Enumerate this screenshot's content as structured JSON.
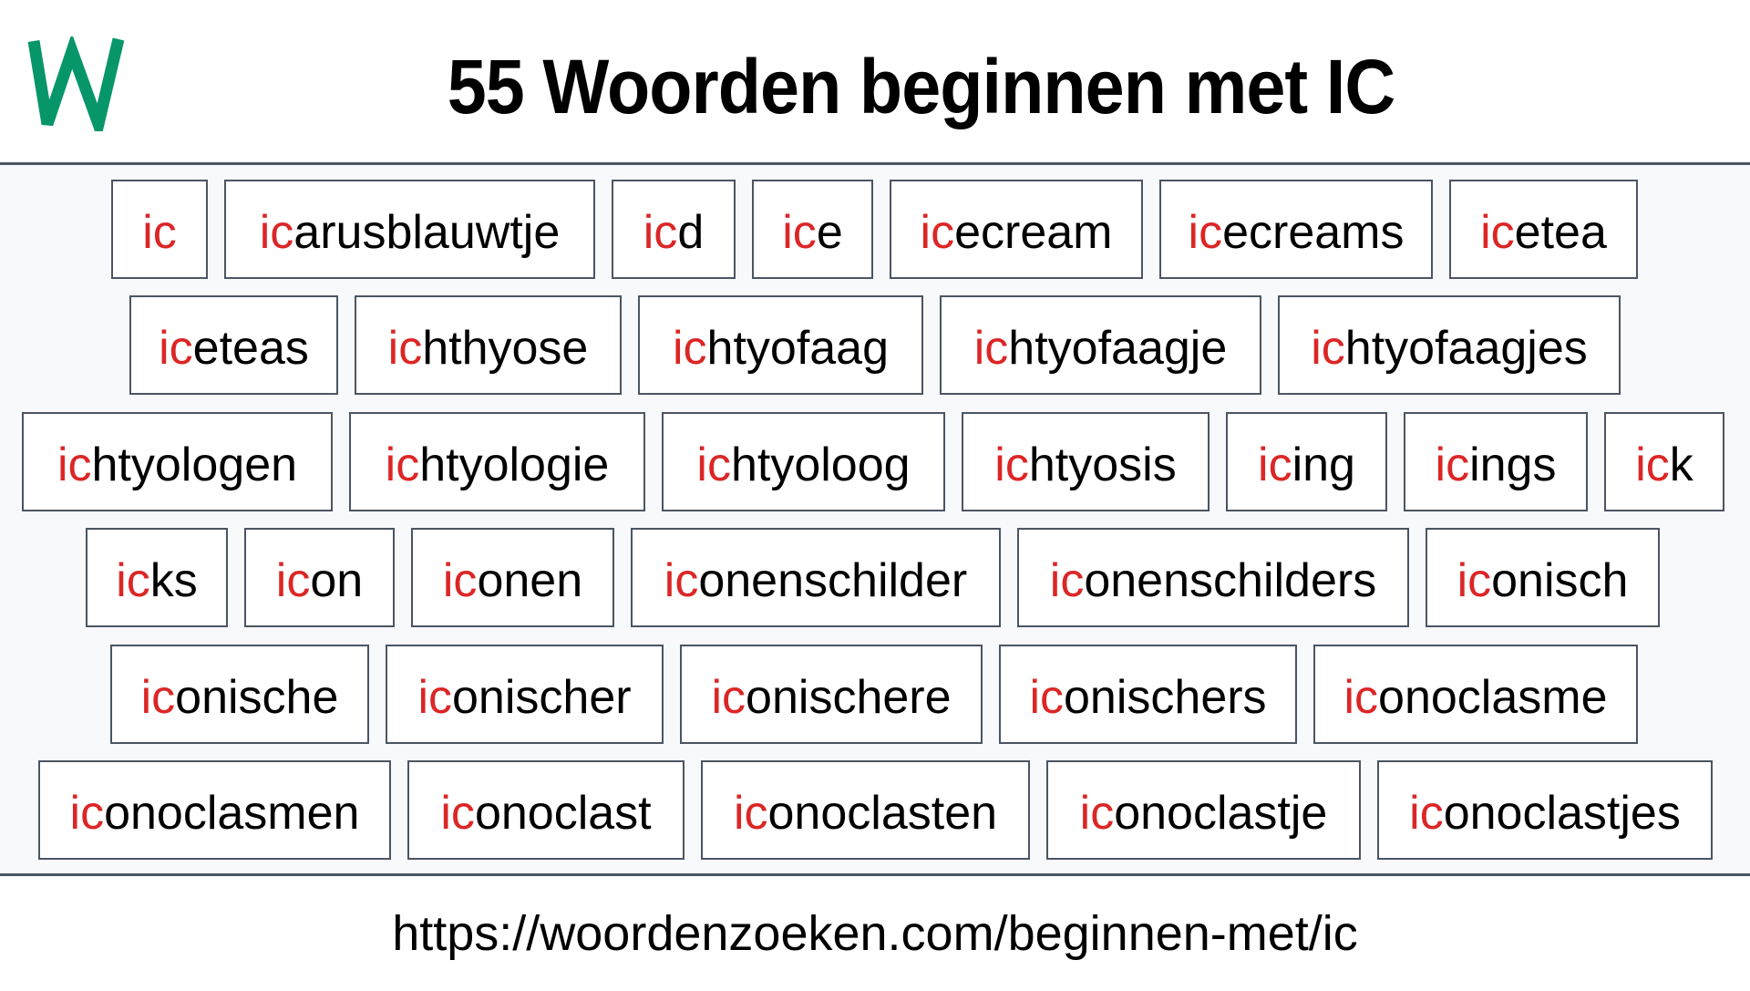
{
  "header": {
    "logo_letter": "W",
    "logo_color": "#079669",
    "title": "55 Woorden beginnen met IC"
  },
  "words": {
    "prefix": "ic",
    "prefix_color": "#dc2626",
    "rows": [
      [
        "ic",
        "icarusblauwtje",
        "icd",
        "ice",
        "icecream",
        "icecreams",
        "icetea"
      ],
      [
        "iceteas",
        "ichthyose",
        "ichtyofaag",
        "ichtyofaagje",
        "ichtyofaagjes"
      ],
      [
        "ichtyologen",
        "ichtyologie",
        "ichtyoloog",
        "ichtyosis",
        "icing",
        "icings",
        "ick"
      ],
      [
        "icks",
        "icon",
        "iconen",
        "iconenschilder",
        "iconenschilders",
        "iconisch"
      ],
      [
        "iconische",
        "iconischer",
        "iconischere",
        "iconischers",
        "iconoclasme"
      ],
      [
        "iconoclasmen",
        "iconoclast",
        "iconoclasten",
        "iconoclastje",
        "iconoclastjes"
      ]
    ]
  },
  "footer": {
    "url": "https://woordenzoeken.com/beginnen-met/ic"
  }
}
